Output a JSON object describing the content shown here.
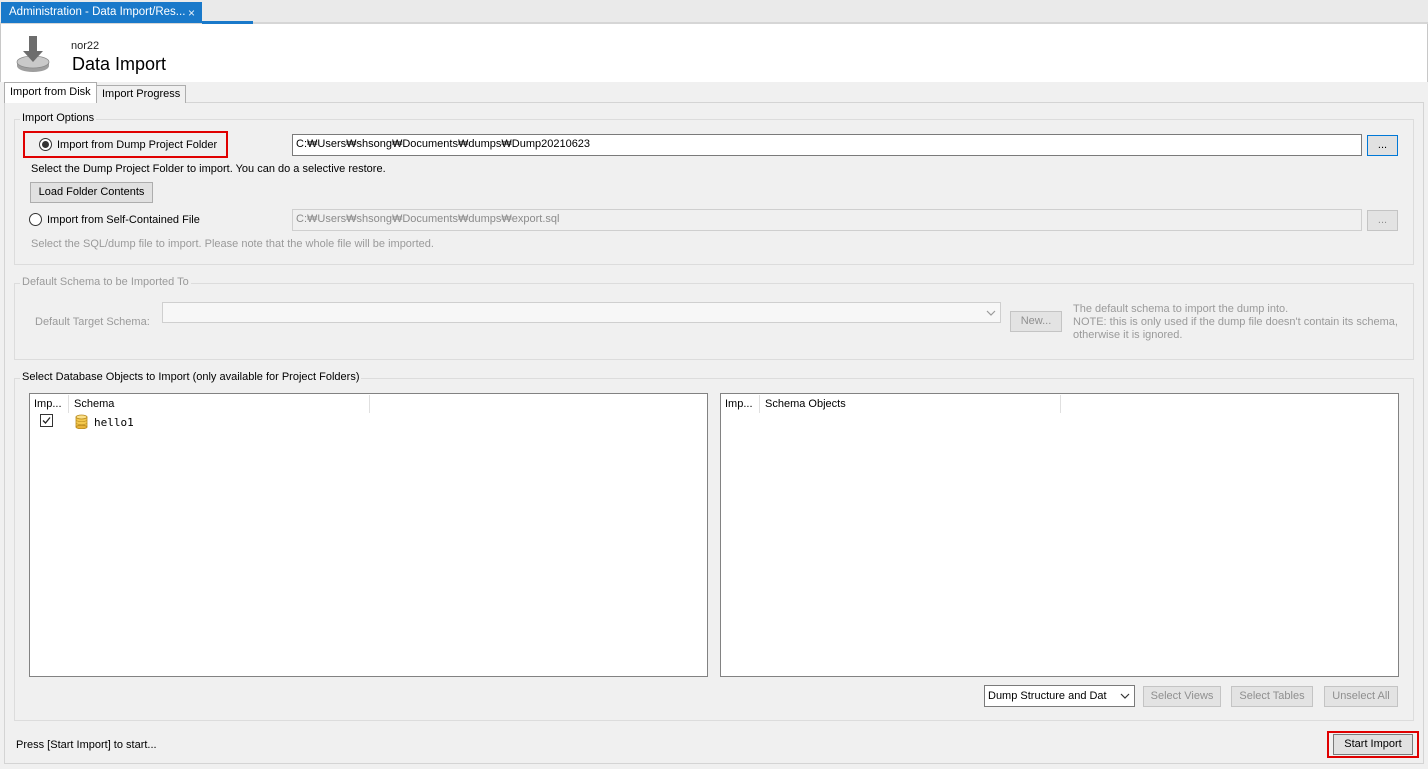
{
  "window": {
    "tab_label": "Administration - Data Import/Res...",
    "close_glyph": "×"
  },
  "header": {
    "server": "nor22",
    "title": "Data Import"
  },
  "tabs": [
    {
      "label": "Import from Disk",
      "active": true
    },
    {
      "label": "Import Progress",
      "active": false
    }
  ],
  "import_options": {
    "title": "Import Options",
    "dump_folder": {
      "label": "Import from Dump Project Folder",
      "selected": true,
      "path": "C:₩Users₩shsong₩Documents₩dumps₩Dump20210623",
      "browse_label": "...",
      "hint": "Select the Dump Project Folder to import. You can do a selective restore.",
      "load_label": "Load Folder Contents"
    },
    "self_contained": {
      "label": "Import from Self-Contained File",
      "selected": false,
      "path": "C:₩Users₩shsong₩Documents₩dumps₩export.sql",
      "browse_label": "...",
      "hint": "Select the SQL/dump file to import. Please note that the whole file will be imported."
    }
  },
  "default_schema": {
    "title": "Default Schema to be Imported To",
    "target_label": "Default Target Schema:",
    "target_value": "",
    "new_label": "New...",
    "note_lines": [
      "The default schema to import the dump into.",
      "NOTE: this is only used if the dump file doesn't contain its schema,",
      "otherwise it is ignored."
    ]
  },
  "objects": {
    "title": "Select Database Objects to Import (only available for Project Folders)",
    "schema_list": {
      "columns": [
        "Imp...",
        "Schema"
      ],
      "rows": [
        {
          "checked": true,
          "name": "hello1"
        }
      ]
    },
    "objects_list": {
      "columns": [
        "Imp...",
        "Schema Objects"
      ],
      "rows": []
    },
    "dump_mode": "Dump Structure and Dat",
    "select_views": "Select Views",
    "select_tables": "Select Tables",
    "unselect_all": "Unselect All"
  },
  "footer": {
    "status": "Press [Start Import] to start...",
    "start_label": "Start Import"
  },
  "icons": {
    "import": "data-import-icon",
    "database": "database-icon",
    "dropdown": "chevron-down-icon"
  },
  "colors": {
    "accent": "#1979ca",
    "highlight": "#e00000",
    "db_icon": "#e8b33a"
  }
}
